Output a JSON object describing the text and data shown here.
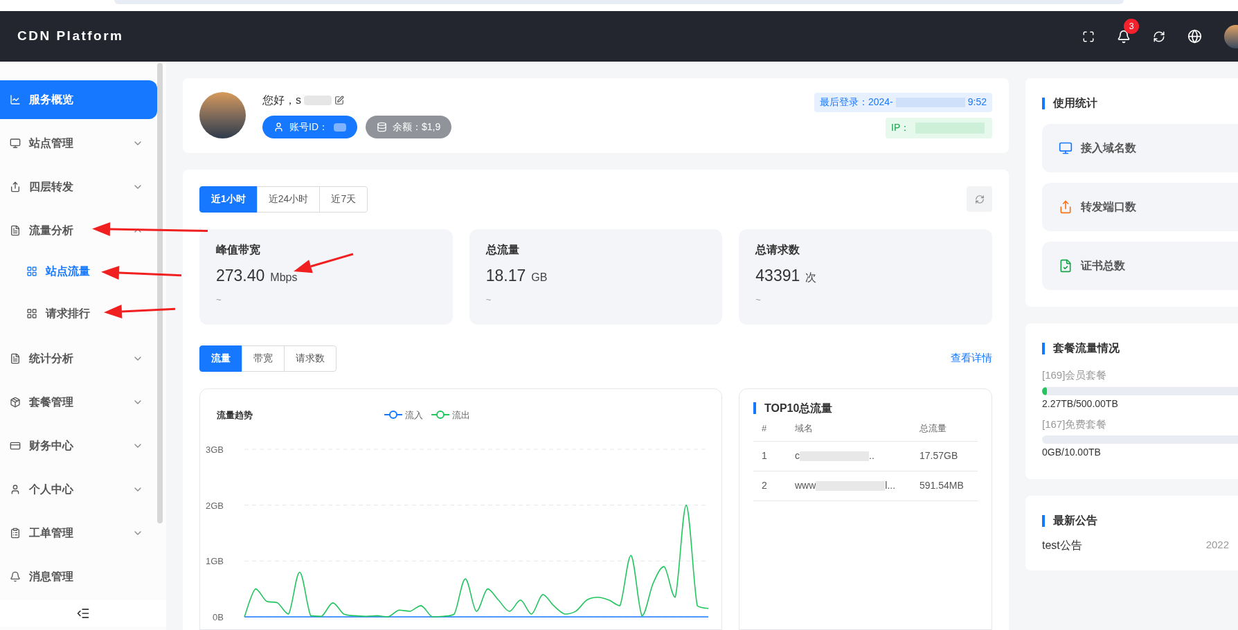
{
  "header": {
    "title": "CDN Platform",
    "notification_count": "3"
  },
  "sidebar": {
    "items": [
      {
        "label": "服务概览",
        "kind": "link",
        "selected": true
      },
      {
        "label": "站点管理",
        "kind": "menu",
        "selected": false,
        "expanded": false
      },
      {
        "label": "四层转发",
        "kind": "menu",
        "selected": false,
        "expanded": false
      },
      {
        "label": "流量分析",
        "kind": "menu",
        "selected": false,
        "expanded": true,
        "children": [
          {
            "label": "站点流量",
            "selected": true
          },
          {
            "label": "请求排行",
            "selected": false
          }
        ]
      },
      {
        "label": "统计分析",
        "kind": "menu",
        "selected": false,
        "expanded": false
      },
      {
        "label": "套餐管理",
        "kind": "menu",
        "selected": false,
        "expanded": false
      },
      {
        "label": "财务中心",
        "kind": "menu",
        "selected": false,
        "expanded": false
      },
      {
        "label": "个人中心",
        "kind": "menu",
        "selected": false,
        "expanded": false
      },
      {
        "label": "工单管理",
        "kind": "menu",
        "selected": false,
        "expanded": false
      },
      {
        "label": "消息管理",
        "kind": "link",
        "selected": false
      }
    ]
  },
  "profile": {
    "greeting": "您好，s",
    "account_id": "账号ID：",
    "balance": "余额：$1,9",
    "last_login_prefix": "最后登录：2024-",
    "last_login_suffix": "9:52",
    "ip_label": "IP："
  },
  "range_tabs": [
    {
      "label": "近1小时",
      "selected": true
    },
    {
      "label": "近24小时",
      "selected": false
    },
    {
      "label": "近7天",
      "selected": false
    }
  ],
  "stats": [
    {
      "title": "峰值带宽",
      "value": "273.40",
      "unit": "Mbps",
      "note": "~"
    },
    {
      "title": "总流量",
      "value": "18.17",
      "unit": "GB",
      "note": "~"
    },
    {
      "title": "总请求数",
      "value": "43391",
      "unit": "次",
      "note": "~"
    }
  ],
  "metric_tabs": [
    {
      "label": "流量",
      "selected": true
    },
    {
      "label": "带宽",
      "selected": false
    },
    {
      "label": "请求数",
      "selected": false
    }
  ],
  "details_link": "查看详情",
  "trend": {
    "chart_data": {
      "type": "line",
      "title": "流量趋势",
      "legend": "top",
      "ylim": [
        0,
        3
      ],
      "yticks": [
        {
          "value": 0,
          "label": "0B"
        },
        {
          "value": 1,
          "label": "1GB"
        },
        {
          "value": 2,
          "label": "2GB"
        },
        {
          "value": 3,
          "label": "3GB"
        }
      ],
      "series": [
        {
          "name": "流入",
          "color": "#1677ff",
          "values": [
            0,
            0,
            0,
            0,
            0,
            0,
            0,
            0,
            0,
            0,
            0,
            0,
            0,
            0,
            0,
            0,
            0,
            0,
            0,
            0,
            0,
            0,
            0,
            0,
            0,
            0,
            0,
            0,
            0,
            0,
            0,
            0,
            0,
            0,
            0,
            0,
            0,
            0,
            0,
            0,
            0,
            0,
            0
          ]
        },
        {
          "name": "流出",
          "color": "#22c55e",
          "values": [
            0,
            0.5,
            0.28,
            0.25,
            0.05,
            0.8,
            0.02,
            0.01,
            0.25,
            0.05,
            0.02,
            0.01,
            0.02,
            0,
            0.12,
            0.1,
            0.2,
            0,
            0.01,
            0.05,
            0.68,
            0.1,
            0.5,
            0.3,
            0.1,
            0.3,
            0.05,
            0.4,
            0.2,
            0.05,
            0.1,
            0.3,
            0.35,
            0.3,
            0.2,
            1.1,
            0.02,
            0.6,
            0.9,
            0.35,
            2.0,
            0.2,
            0.15
          ]
        }
      ]
    }
  },
  "top10": {
    "title": "TOP10总流量",
    "columns": [
      "#",
      "域名",
      "总流量"
    ],
    "rows": [
      {
        "rank": "1",
        "domain_start": "c",
        "domain_end": "..",
        "traffic": "17.57GB"
      },
      {
        "rank": "2",
        "domain_start": "www",
        "domain_end": "l...",
        "traffic": "591.54MB"
      }
    ]
  },
  "usage": {
    "title": "使用统计",
    "items": [
      {
        "label": "接入域名数",
        "color": "#1677ff"
      },
      {
        "label": "转发端口数",
        "color": "#f97316"
      },
      {
        "label": "证书总数",
        "color": "#16a34a"
      }
    ]
  },
  "plans": {
    "title": "套餐流量情况",
    "items": [
      {
        "name": "[169]会员套餐",
        "level": 0.0045,
        "usage": "2.27TB/500.00TB"
      },
      {
        "name": "[167]免费套餐",
        "level": 0,
        "usage": "0GB/10.00TB"
      }
    ]
  },
  "notices": {
    "title": "最新公告",
    "items": [
      {
        "title": "test公告",
        "date": "2022"
      }
    ]
  }
}
